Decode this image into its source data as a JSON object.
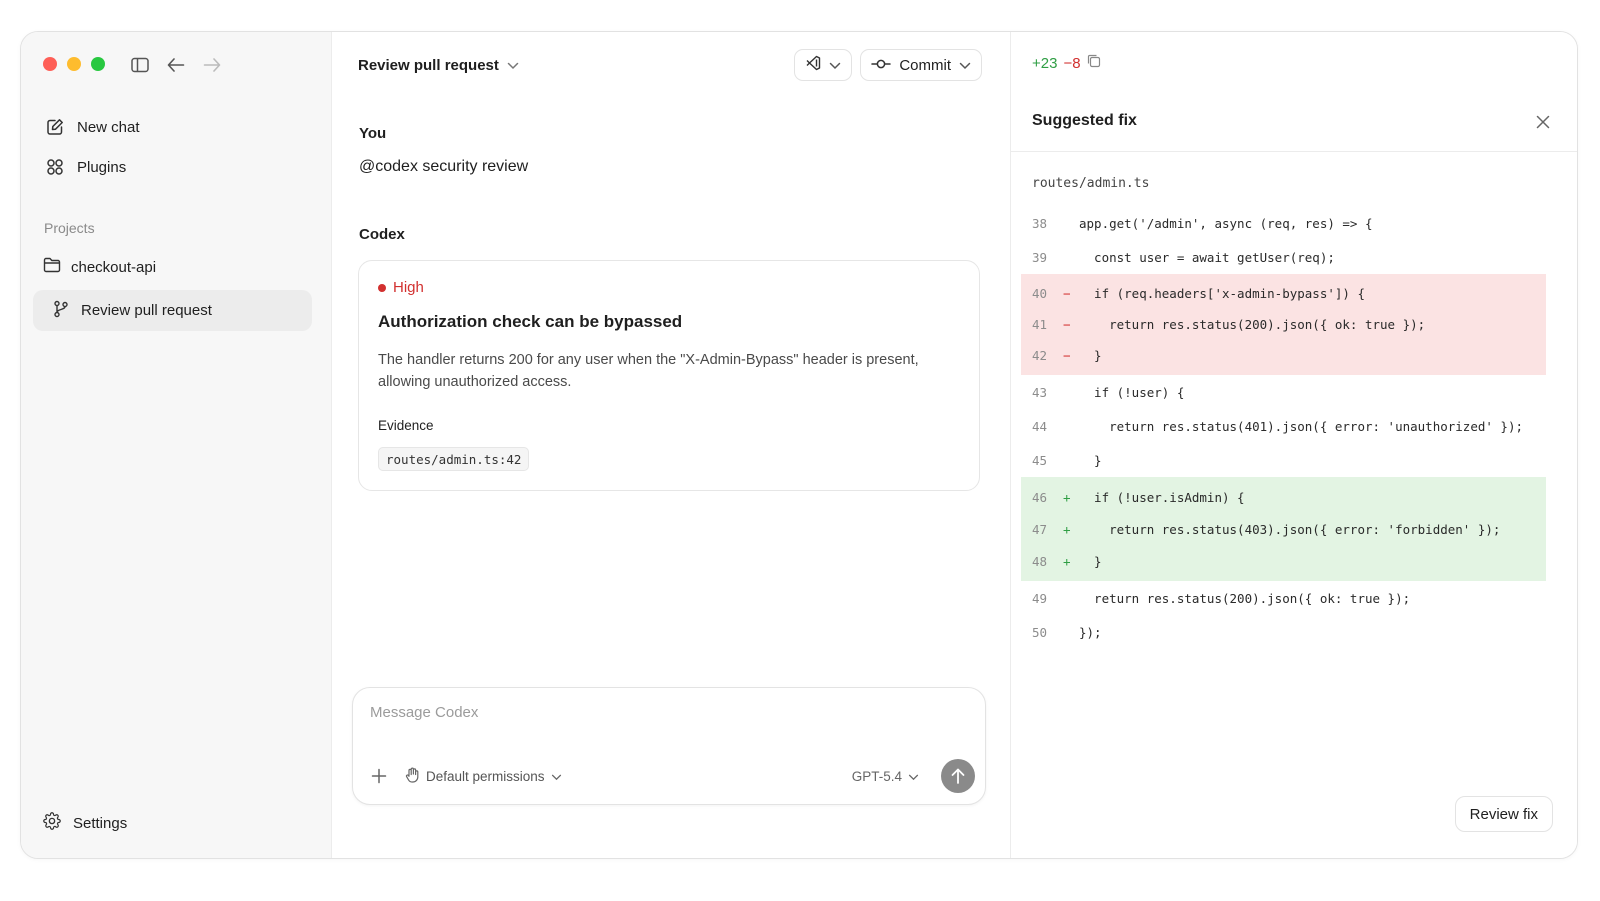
{
  "colors": {
    "accent_red": "#d2302f",
    "accent_green": "#2f9e44",
    "del_bg": "#fbe3e3",
    "add_bg": "#e3f4e3"
  },
  "sidebar": {
    "new_chat": "New chat",
    "plugins": "Plugins",
    "projects_label": "Projects",
    "project": "checkout-api",
    "active_thread": "Review pull request",
    "settings": "Settings"
  },
  "main": {
    "title": "Review pull request",
    "commit_label": "Commit",
    "you_label": "You",
    "you_message": "@codex security review",
    "codex_label": "Codex",
    "finding": {
      "severity": "High",
      "title": "Authorization check can be bypassed",
      "description": "The handler returns 200 for any user when the \"X-Admin-Bypass\" header is present, allowing unauthorized access.",
      "evidence_label": "Evidence",
      "evidence_ref": "routes/admin.ts:42"
    },
    "composer": {
      "placeholder": "Message Codex",
      "permissions": "Default permissions",
      "model": "GPT-5.4"
    }
  },
  "panel": {
    "additions": "+23",
    "deletions": "−8",
    "title": "Suggested fix",
    "file": "routes/admin.ts",
    "review_button": "Review fix",
    "lines": [
      {
        "n": "38",
        "mark": "",
        "type": "ctx",
        "text": "app.get('/admin', async (req, res) => {"
      },
      {
        "n": "39",
        "mark": "",
        "type": "ctx",
        "text": "  const user = await getUser(req);"
      },
      {
        "n": "40",
        "mark": "−",
        "type": "del",
        "text": "  if (req.headers['x-admin-bypass']) {"
      },
      {
        "n": "41",
        "mark": "−",
        "type": "del",
        "text": "    return res.status(200).json({ ok: true });"
      },
      {
        "n": "42",
        "mark": "−",
        "type": "del",
        "text": "  }"
      },
      {
        "n": "43",
        "mark": "",
        "type": "ctx",
        "text": "  if (!user) {"
      },
      {
        "n": "44",
        "mark": "",
        "type": "ctx",
        "text": "    return res.status(401).json({ error: 'unauthorized' });"
      },
      {
        "n": "45",
        "mark": "",
        "type": "ctx",
        "text": "  }"
      },
      {
        "n": "46",
        "mark": "+",
        "type": "add",
        "text": "  if (!user.isAdmin) {"
      },
      {
        "n": "47",
        "mark": "+",
        "type": "add",
        "text": "    return res.status(403).json({ error: 'forbidden' });"
      },
      {
        "n": "48",
        "mark": "+",
        "type": "add",
        "text": "  }"
      },
      {
        "n": "49",
        "mark": "",
        "type": "ctx",
        "text": "  return res.status(200).json({ ok: true });"
      },
      {
        "n": "50",
        "mark": "",
        "type": "ctx",
        "text": "});"
      }
    ]
  }
}
